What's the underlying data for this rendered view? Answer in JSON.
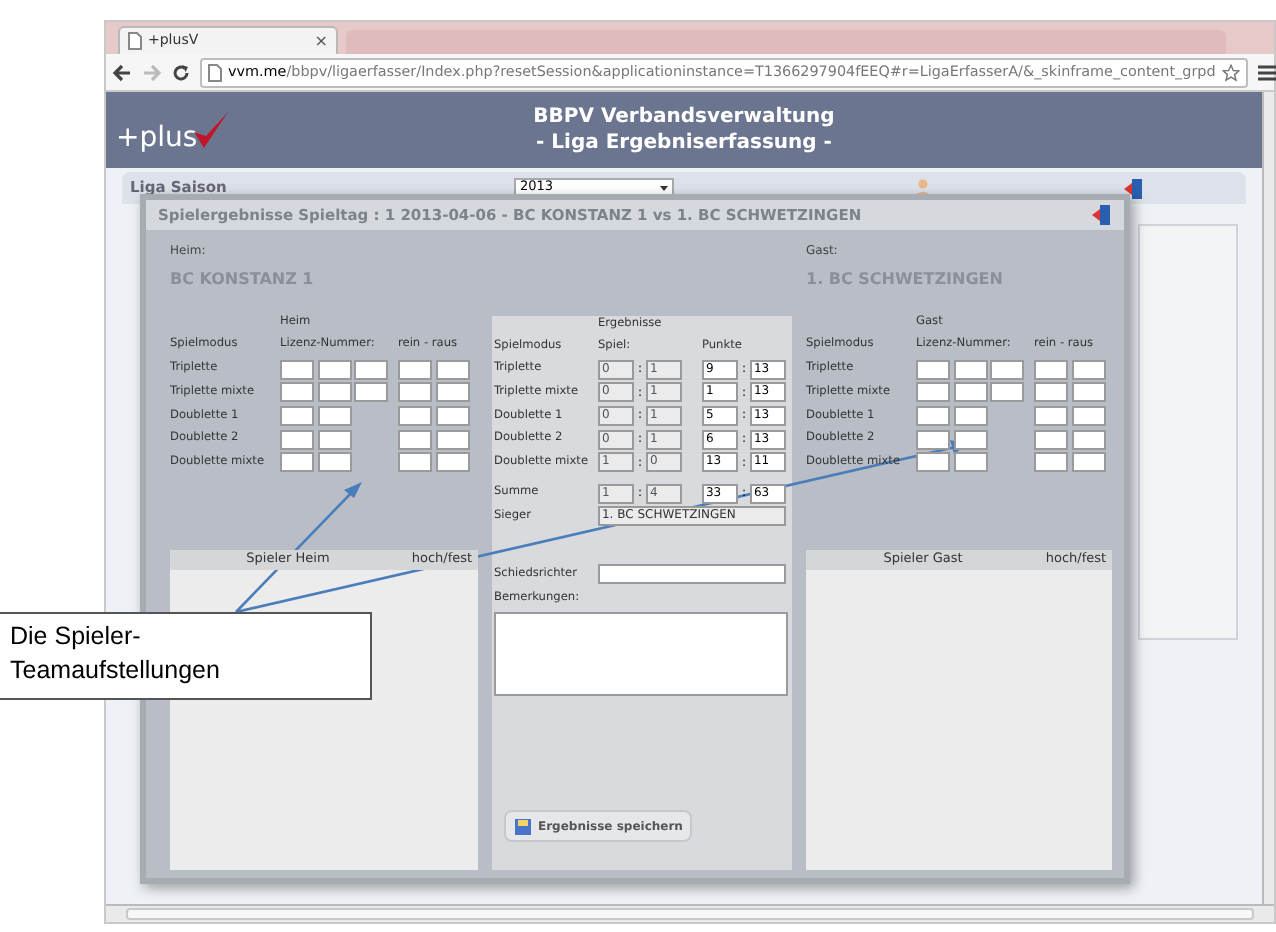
{
  "browser": {
    "tab": {
      "title": "+plusV",
      "close": "×"
    },
    "url": {
      "host": "vvm.me",
      "path": "/bbpv/ligaerfasser/Index.php?resetSession&applicationinstance=T1366297904fEEQ#r=LigaErfasserA/&_skinframe_content_grpd"
    }
  },
  "app": {
    "logo": "+plus",
    "title": [
      "BBPV Verbandsverwaltung",
      "- Liga Ergebniserfassung -"
    ]
  },
  "filter": {
    "label": "Liga Saison",
    "season": "2013"
  },
  "dialog": {
    "title": "Spielergebnisse Spieltag : 1 2013-04-06 - BC KONSTANZ 1 vs 1. BC SCHWETZINGEN",
    "home": {
      "label": "Heim:",
      "team": "BC KONSTANZ 1",
      "section": "Heim",
      "columns": [
        "Spielmodus",
        "Lizenz-Nummer:",
        "rein - raus"
      ],
      "rows": [
        {
          "mode": "Triplette",
          "kind": "triplette"
        },
        {
          "mode": "Triplette mixte",
          "kind": "triplette"
        },
        {
          "mode": "Doublette 1",
          "kind": "doublette"
        },
        {
          "mode": "Doublette 2",
          "kind": "doublette"
        },
        {
          "mode": "Doublette mixte",
          "kind": "doublette"
        }
      ],
      "players": [
        "Spieler Heim",
        "hoch/fest"
      ]
    },
    "results": {
      "section": "Ergebnisse",
      "columns": [
        "Spielmodus",
        "Spiel:",
        "Punkte"
      ],
      "separator": ":",
      "rows": [
        {
          "mode": "Triplette",
          "spiel": [
            "0",
            "1"
          ],
          "punkte": [
            "9",
            "13"
          ]
        },
        {
          "mode": "Triplette mixte",
          "spiel": [
            "0",
            "1"
          ],
          "punkte": [
            "1",
            "13"
          ]
        },
        {
          "mode": "Doublette 1",
          "spiel": [
            "0",
            "1"
          ],
          "punkte": [
            "5",
            "13"
          ]
        },
        {
          "mode": "Doublette 2",
          "spiel": [
            "0",
            "1"
          ],
          "punkte": [
            "6",
            "13"
          ]
        },
        {
          "mode": "Doublette mixte",
          "spiel": [
            "1",
            "0"
          ],
          "punkte": [
            "13",
            "11"
          ]
        }
      ],
      "sum": {
        "label": "Summe",
        "spiel": [
          "1",
          "4"
        ],
        "punkte": [
          "33",
          "63"
        ]
      },
      "winner": {
        "label": "Sieger",
        "value": "1. BC SCHWETZINGEN"
      },
      "referee": {
        "label": "Schiedsrichter"
      },
      "remarks": {
        "label": "Bemerkungen:"
      },
      "save_button": "Ergebnisse speichern"
    },
    "guest": {
      "label": "Gast:",
      "team": "1. BC SCHWETZINGEN",
      "section": "Gast",
      "columns": [
        "Spielmodus",
        "Lizenz-Nummer:",
        "rein - raus"
      ],
      "rows": [
        {
          "mode": "Triplette",
          "kind": "triplette"
        },
        {
          "mode": "Triplette mixte",
          "kind": "triplette"
        },
        {
          "mode": "Doublette 1",
          "kind": "doublette"
        },
        {
          "mode": "Doublette 2",
          "kind": "doublette"
        },
        {
          "mode": "Doublette mixte",
          "kind": "doublette"
        }
      ],
      "players": [
        "Spieler Gast",
        "hoch/fest"
      ]
    }
  },
  "callout": {
    "text": "Die Spieler-Teamaufstellungen"
  }
}
